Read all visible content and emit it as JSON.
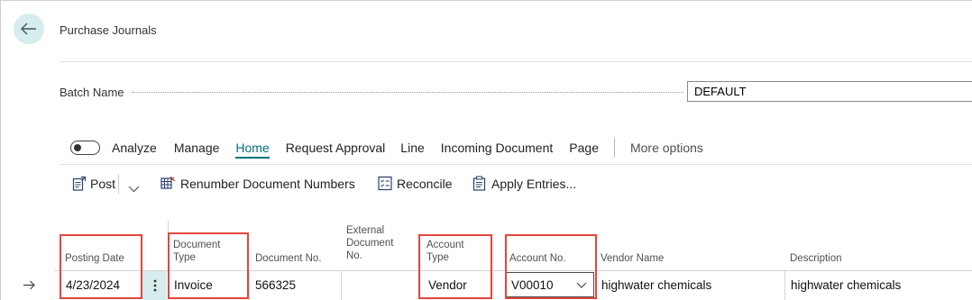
{
  "header": {
    "title": "Purchase Journals"
  },
  "batch": {
    "label": "Batch Name",
    "value": "DEFAULT"
  },
  "tabs": {
    "analyze_label": "Analyze",
    "items": [
      "Manage",
      "Home",
      "Request Approval",
      "Line",
      "Incoming Document",
      "Page"
    ],
    "active": "Home",
    "more": "More options"
  },
  "actions": {
    "post": "Post",
    "renumber": "Renumber Document Numbers",
    "reconcile": "Reconcile",
    "apply_entries": "Apply Entries..."
  },
  "table": {
    "columns": {
      "posting_date": "Posting Date",
      "document_type": [
        "Document",
        "Type"
      ],
      "document_no": "Document No.",
      "external_document_no": [
        "External",
        "Document",
        "No."
      ],
      "account_type": [
        "Account",
        "Type"
      ],
      "account_no": "Account No.",
      "vendor_name": "Vendor Name",
      "description": "Description"
    },
    "row": {
      "posting_date": "4/23/2024",
      "document_type": "Invoice",
      "document_no": "566325",
      "external_document_no": "",
      "account_type": "Vendor",
      "account_no": "V00010",
      "vendor_name": "highwater chemicals",
      "description": "highwater chemicals"
    }
  },
  "colors": {
    "accent": "#00707a",
    "highlight": "#e3463c",
    "back_button_bg": "#d7ecec"
  }
}
